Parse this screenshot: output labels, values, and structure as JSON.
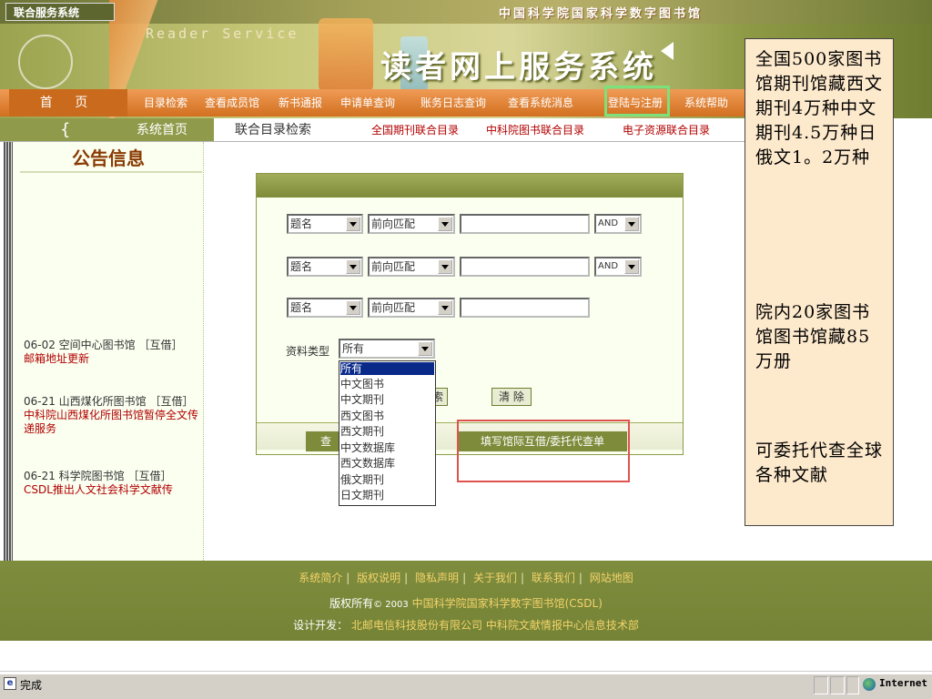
{
  "header": {
    "system_name": "联合服务系统",
    "reader_service": "Reader Service",
    "top_title": "中国科学院国家科学数字图书馆",
    "main_title": "读者网上服务系统"
  },
  "nav": {
    "home": "首 页",
    "items": [
      "目录检索",
      "查看成员馆",
      "新书通报",
      "申请单查询",
      "账务日志查询",
      "查看系统消息",
      "登陆与注册",
      "系统帮助"
    ]
  },
  "subnav": {
    "system_home": "系统首页",
    "union_title": "联合目录检索",
    "links": [
      "全国期刊联合目录",
      "中科院图书联合目录",
      "电子资源联合目录"
    ]
  },
  "notice": {
    "title": "公告信息",
    "items": [
      {
        "date": "06-02 空间中心图书馆 ［互借］",
        "sub": "邮箱地址更新"
      },
      {
        "date": "06-21 山西煤化所图书馆 ［互借］",
        "sub": "中科院山西煤化所图书馆暂停全文传递服务"
      },
      {
        "date": "06-21 科学院图书馆 ［互借］",
        "sub": "CSDL推出人文社会科学文献传"
      }
    ]
  },
  "form": {
    "rows": [
      {
        "field": "题名",
        "match": "前向匹配",
        "value": "",
        "logic": "AND"
      },
      {
        "field": "题名",
        "match": "前向匹配",
        "value": "",
        "logic": "AND"
      },
      {
        "field": "题名",
        "match": "前向匹配",
        "value": ""
      }
    ],
    "type_label": "资料类型",
    "type_selected": "所有",
    "type_options": [
      "所有",
      "中文图书",
      "中文期刊",
      "西文图书",
      "西文期刊",
      "中文数据库",
      "西文数据库",
      "俄文期刊",
      "日文期刊"
    ],
    "search_btn_partial": "索",
    "clear_btn": "清 除",
    "query_btn_partial": "查",
    "ill_btn": "填写馆际互借/委托代查单"
  },
  "info": {
    "block1": "全国500家图书馆期刊馆藏西文期刊4万种中文期刊4.5万种日俄文1。2万种",
    "block2": "院内20家图书馆图书馆藏85万册",
    "block3": "可委托代查全球各种文献"
  },
  "footer": {
    "links": [
      "系统简介",
      "版权说明",
      "隐私声明",
      "关于我们",
      "联系我们",
      "网站地图"
    ],
    "copyright_prefix": "版权所有",
    "copyright_year": "© 2003",
    "copyright_org": "中国科学院国家科学数字图书馆(CSDL)",
    "dev_prefix": "设计开发：",
    "dev_org": "北邮电信科技股份有限公司 中科院文献情报中心信息技术部"
  },
  "status": {
    "text": "完成",
    "zone": "Internet"
  }
}
